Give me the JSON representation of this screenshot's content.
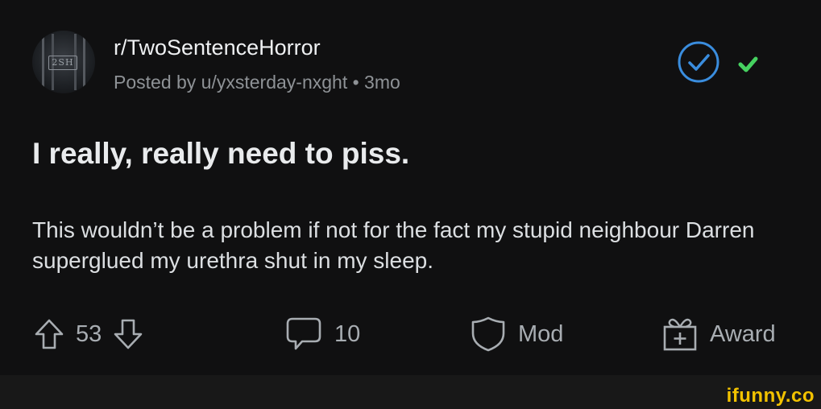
{
  "header": {
    "subreddit": "r/TwoSentenceHorror",
    "posted_by": "Posted by u/yxsterday-nxght • 3mo",
    "avatar_text": "2SH"
  },
  "post": {
    "title": "I really, really need to piss.",
    "body": "This wouldn’t be a problem if not for the fact my stupid neighbour Darren superglued my urethra shut in my sleep."
  },
  "actions": {
    "votes": "53",
    "comments": "10",
    "mod_label": "Mod",
    "award_label": "Award"
  },
  "watermark": "ifunny.co",
  "colors": {
    "join_ring": "#3a8dde",
    "join_check": "#46d160",
    "watermark": "#f2c200"
  },
  "icons": [
    "upvote-icon",
    "downvote-icon",
    "comment-icon",
    "shield-icon",
    "gift-icon",
    "check-circle-icon"
  ]
}
